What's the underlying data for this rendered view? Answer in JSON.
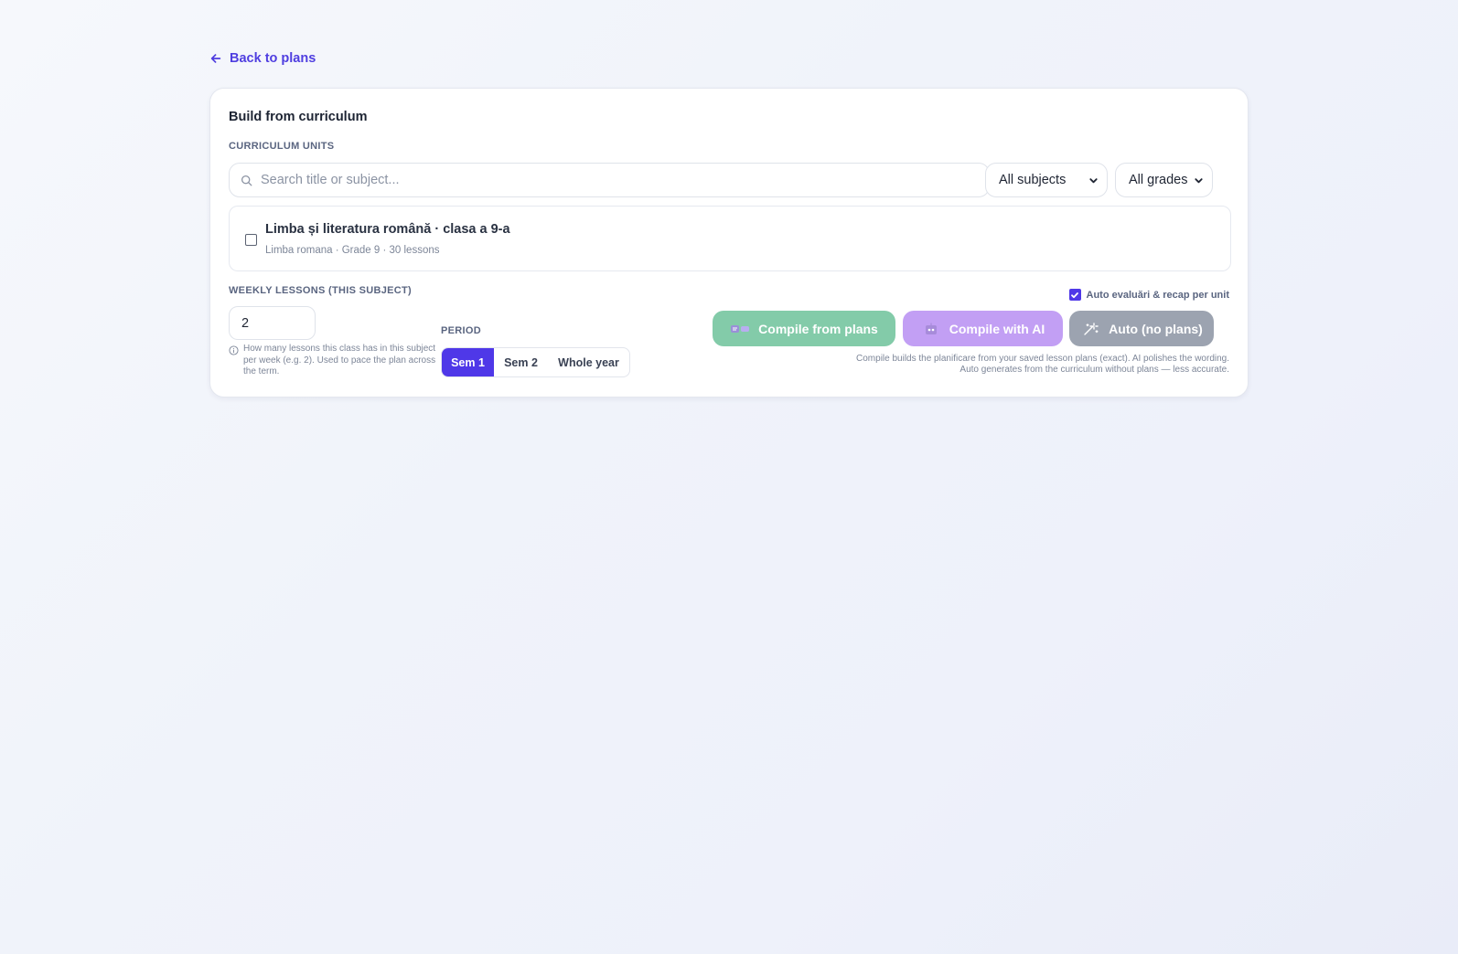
{
  "nav": {
    "back_label": "Back to plans"
  },
  "card": {
    "title": "Build from curriculum",
    "units_label": "CURRICULUM UNITS",
    "search": {
      "placeholder": "Search title or subject...",
      "value": ""
    },
    "filters": {
      "subject": "All subjects",
      "grade": "All grades"
    },
    "units": [
      {
        "title": "Limba și literatura română · clasa a 9-a",
        "meta": "Limba romana · Grade 9 · 30 lessons",
        "checked": false
      }
    ],
    "weekly": {
      "label": "WEEKLY LESSONS (THIS SUBJECT)",
      "value": "2",
      "hint": "How many lessons this class has in this subject per week (e.g. 2). Used to pace the plan across the term."
    },
    "period": {
      "label": "PERIOD",
      "options": [
        "Sem 1",
        "Sem 2",
        "Whole year"
      ],
      "selected": "Sem 1"
    },
    "auto_eval": {
      "label": "Auto evaluări & recap per unit",
      "checked": true
    },
    "actions": {
      "compile": "Compile from plans",
      "ai": "Compile with AI",
      "auto": "Auto (no plans)"
    },
    "footnote_line1": "Compile builds the planificare from your saved lesson plans (exact). AI polishes the wording.",
    "footnote_line2": "Auto generates from the curriculum without plans — less accurate."
  },
  "colors": {
    "accent": "#4f38e8",
    "compile_btn": "#83cba9",
    "ai_btn": "#c29ff4",
    "auto_btn": "#9ca3b0"
  },
  "icons": {
    "back": "arrow-left-icon",
    "search": "search-icon",
    "select": "chevron-down-icon",
    "hint": "info-icon",
    "compile": "plans-icon",
    "ai": "robot-icon",
    "auto": "magic-wand-icon"
  }
}
